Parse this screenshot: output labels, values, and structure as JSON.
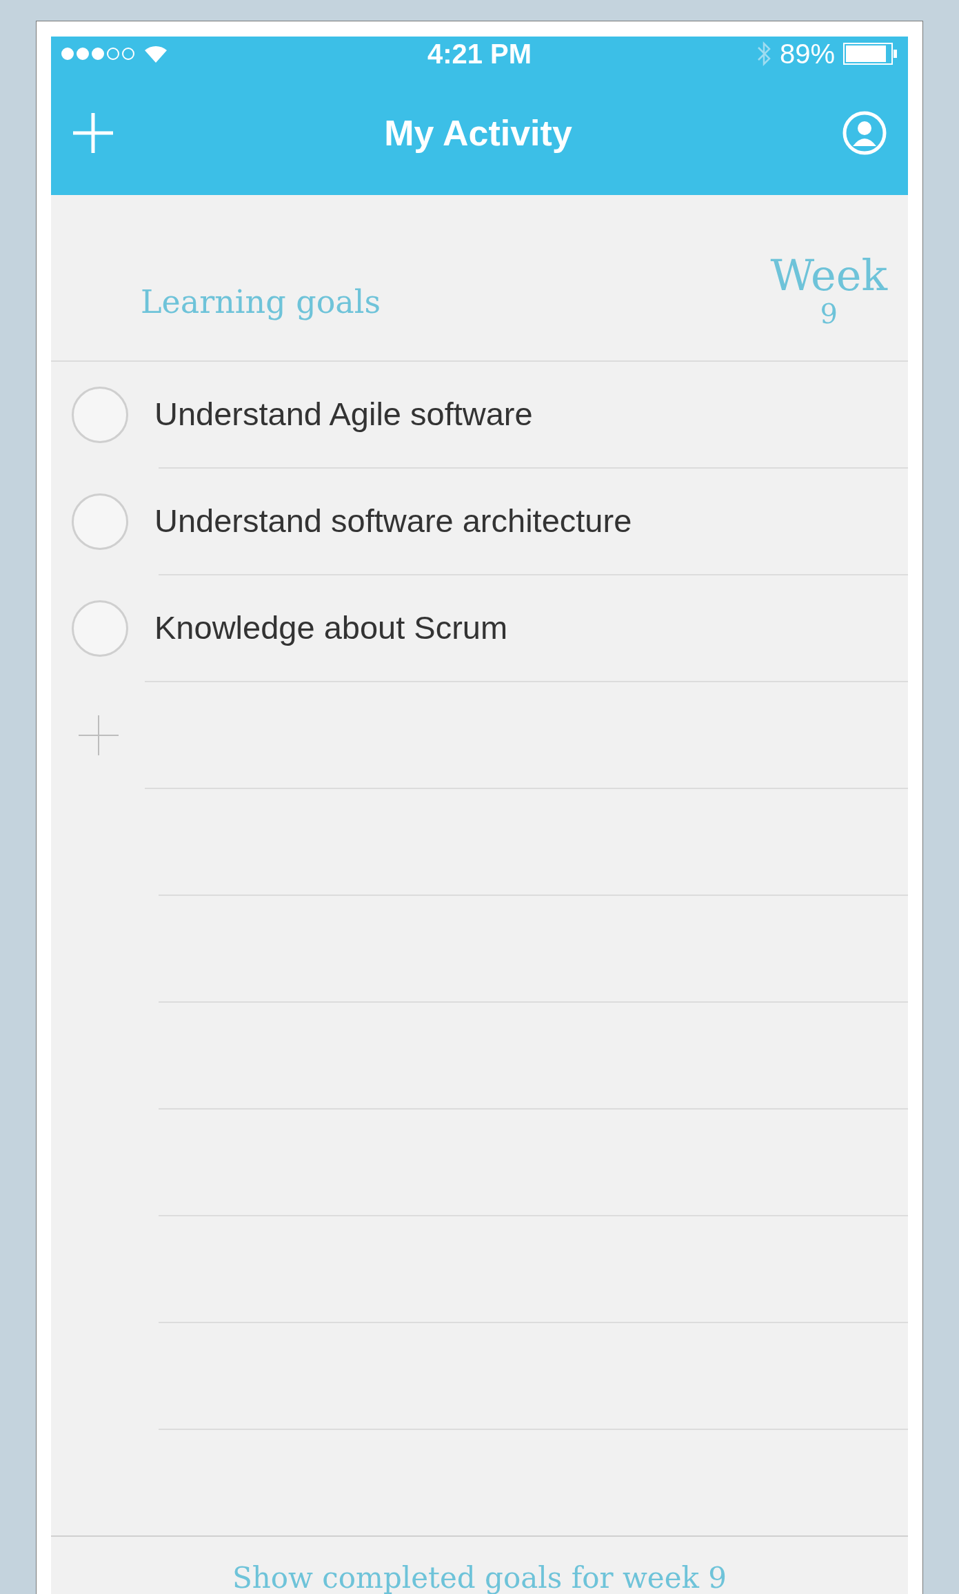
{
  "status_bar": {
    "time": "4:21 PM",
    "battery": "89%"
  },
  "nav_bar": {
    "title": "My Activity"
  },
  "header": {
    "section_title": "Learning goals",
    "week_label": "Week",
    "week_number": "9"
  },
  "goals": [
    {
      "text": "Understand Agile software",
      "checked": false
    },
    {
      "text": "Understand software architecture",
      "checked": false
    },
    {
      "text": "Knowledge about Scrum",
      "checked": false
    }
  ],
  "footer": {
    "link": "Show completed goals for week 9"
  }
}
